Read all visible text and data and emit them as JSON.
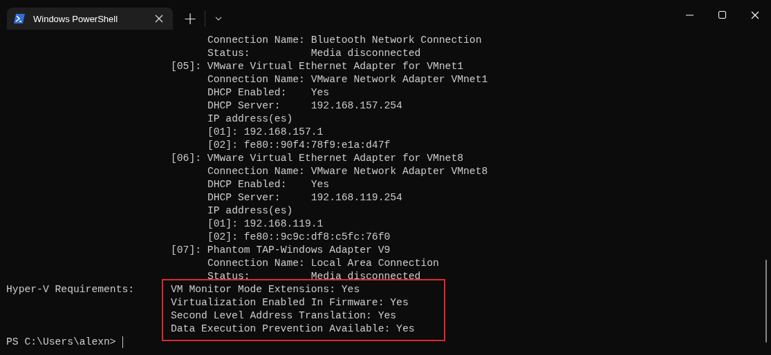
{
  "tab": {
    "title": "Windows PowerShell",
    "selected": true
  },
  "new_tab": "+",
  "output_lines": [
    "                                 Connection Name: Bluetooth Network Connection",
    "                                 Status:          Media disconnected",
    "                           [05]: VMware Virtual Ethernet Adapter for VMnet1",
    "                                 Connection Name: VMware Network Adapter VMnet1",
    "                                 DHCP Enabled:    Yes",
    "                                 DHCP Server:     192.168.157.254",
    "                                 IP address(es)",
    "                                 [01]: 192.168.157.1",
    "                                 [02]: fe80::90f4:78f9:e1a:d47f",
    "                           [06]: VMware Virtual Ethernet Adapter for VMnet8",
    "                                 Connection Name: VMware Network Adapter VMnet8",
    "                                 DHCP Enabled:    Yes",
    "                                 DHCP Server:     192.168.119.254",
    "                                 IP address(es)",
    "                                 [01]: 192.168.119.1",
    "                                 [02]: fe80::9c9c:df8:c5fc:76f0",
    "                           [07]: Phantom TAP-Windows Adapter V9",
    "                                 Connection Name: Local Area Connection",
    "                                 Status:          Media disconnected"
  ],
  "hyperv": {
    "label": "Hyper-V Requirements:",
    "highlighted": true,
    "items": [
      "VM Monitor Mode Extensions: Yes",
      "Virtualization Enabled In Firmware: Yes",
      "Second Level Address Translation: Yes",
      "Data Execution Prevention Available: Yes"
    ]
  },
  "prompt": "PS C:\\Users\\alexn>"
}
